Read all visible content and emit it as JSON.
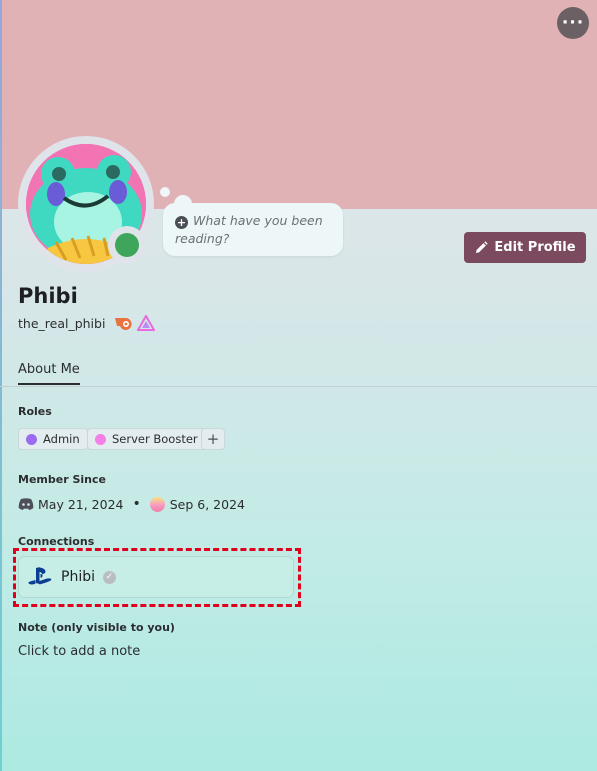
{
  "profile": {
    "display_name": "Phibi",
    "username": "the_real_phibi",
    "status_bubble": "What have you been reading?",
    "edit_button": "Edit Profile"
  },
  "tabs": [
    {
      "label": "About Me",
      "active": true
    }
  ],
  "roles": {
    "label": "Roles",
    "items": [
      {
        "name": "Admin",
        "color": "#9b6cf2"
      },
      {
        "name": "Server Booster",
        "color": "#f47fe8"
      }
    ]
  },
  "member_since": {
    "label": "Member Since",
    "discord_date": "May 21, 2024",
    "separator": "•",
    "server_date": "Sep 6, 2024"
  },
  "connections": {
    "label": "Connections",
    "items": [
      {
        "platform": "playstation-icon",
        "name": "Phibi",
        "verified": true
      }
    ]
  },
  "note": {
    "label": "Note (only visible to you)",
    "placeholder": "Click to add a note"
  },
  "colors": {
    "banner": "#e1b2b5",
    "accent_button": "#7b4a5e",
    "status_online": "#3ea65a",
    "highlight": "#e0001b"
  }
}
